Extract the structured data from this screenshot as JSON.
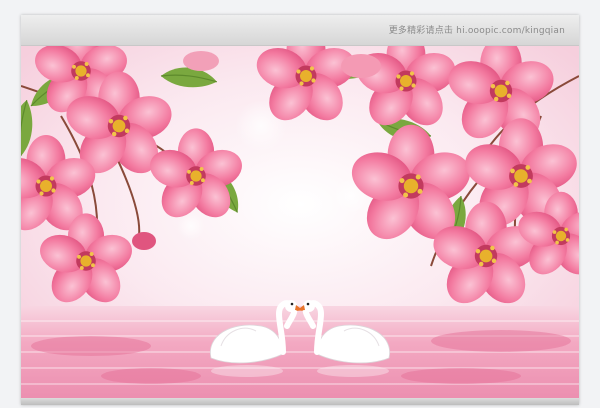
{
  "watermark": {
    "text": "更多精彩请点击 hi.ooopic.com/kingqian"
  },
  "scene": {
    "subject": "two-swans-heart-shape",
    "colors": {
      "flower_pink": "#f06a93",
      "flower_light": "#f79ab5",
      "flower_center": "#e0a020",
      "leaf_green": "#6f9a3a",
      "water_pink": "#f4b6c9",
      "swan_white": "#ffffff",
      "beak_orange": "#e8742a"
    }
  }
}
